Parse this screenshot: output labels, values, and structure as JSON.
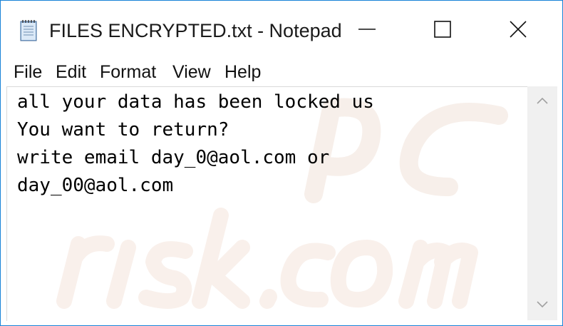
{
  "window": {
    "title": "FILES ENCRYPTED.txt - Notepad",
    "accent_color": "#1883d7",
    "icons": {
      "app": "notepad-icon",
      "minimize": "minimize-icon",
      "maximize": "maximize-icon",
      "close": "close-icon"
    }
  },
  "menu": {
    "items": [
      "File",
      "Edit",
      "Format",
      "View",
      "Help"
    ]
  },
  "editor": {
    "lines": [
      "all your data has been locked us",
      "You want to return?",
      "write email day_0@aol.com or",
      "day_00@aol.com"
    ]
  },
  "scrollbar": {
    "up_icon": "chevron-up-icon",
    "down_icon": "chevron-down-icon"
  }
}
